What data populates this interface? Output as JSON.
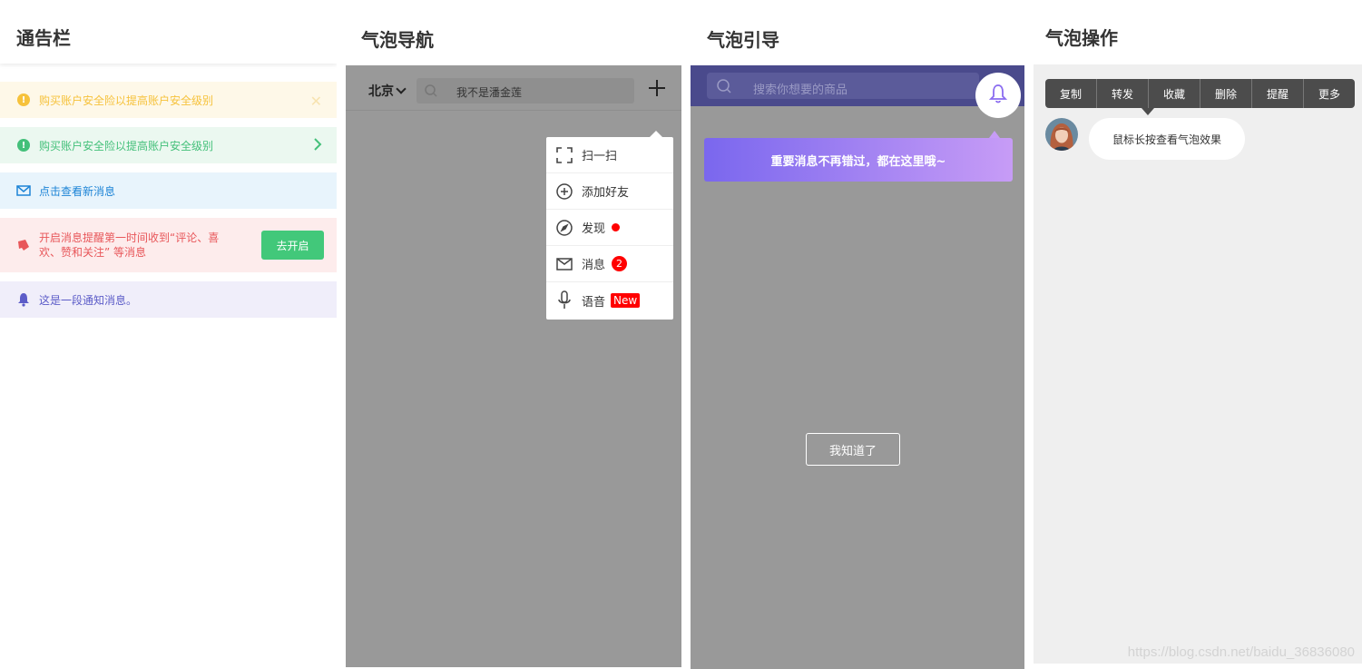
{
  "panel1": {
    "title": "通告栏",
    "notices": [
      {
        "text": "购买账户安全险以提高账户安全级别",
        "icon": "warning-icon",
        "color": "#f6c23c"
      },
      {
        "text": "购买账户安全险以提高账户安全级别",
        "icon": "warning-icon",
        "color": "#44c07a"
      },
      {
        "text": "点击查看新消息",
        "icon": "mail-icon",
        "color": "#1d84d6"
      },
      {
        "text": "开启消息提醒第一时间收到“评论、喜欢、赞和关注” 等消息",
        "icon": "notification-icon",
        "color": "#e8575a",
        "button": "去开启"
      },
      {
        "text": "这是一段通知消息。",
        "icon": "bell-icon",
        "color": "#5c5cc8"
      }
    ]
  },
  "panel2": {
    "title": "气泡导航",
    "city": "北京",
    "search_text": "我不是潘金莲",
    "menu": [
      {
        "label": "扫一扫",
        "icon": "scan-icon"
      },
      {
        "label": "添加好友",
        "icon": "add-friend-icon"
      },
      {
        "label": "发现",
        "icon": "compass-icon"
      },
      {
        "label": "消息",
        "icon": "mail-icon",
        "badge": "2"
      },
      {
        "label": "语音",
        "icon": "microphone-icon",
        "tag": "New"
      }
    ]
  },
  "panel3": {
    "title": "气泡引导",
    "search_placeholder": "搜索你想要的商品",
    "guide_text": "重要消息不再错过，都在这里哦~",
    "button": "我知道了"
  },
  "panel4": {
    "title": "气泡操作",
    "actions": [
      "复制",
      "转发",
      "收藏",
      "删除",
      "提醒",
      "更多"
    ],
    "message": "鼠标长按查看气泡效果"
  },
  "watermark": "https://blog.csdn.net/baidu_36836080"
}
